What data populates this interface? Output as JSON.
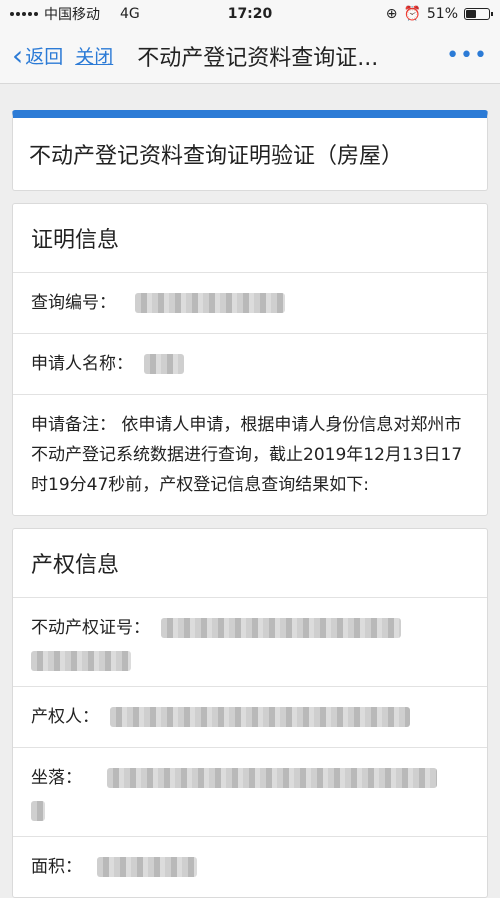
{
  "status_bar": {
    "carrier": "中国移动",
    "network": "4G",
    "time": "17:20",
    "battery": "51%",
    "battery_level": 0.51
  },
  "nav": {
    "back_label": "返回",
    "close_label": "关闭",
    "title": "不动产登记资料查询证..."
  },
  "document_title": "不动产登记资料查询证明验证（房屋）",
  "certificate_info": {
    "heading": "证明信息",
    "query_no_label": "查询编号：",
    "applicant_label": "申请人名称：",
    "remark": "申请备注： 依申请人申请，根据申请人身份信息对郑州市不动产登记系统数据进行查询，截止2019年12月13日17时19分47秒前，产权登记信息查询结果如下:"
  },
  "property_info": {
    "heading": "产权信息",
    "cert_no_label": "不动产权证号：",
    "owner_label": "产权人：",
    "location_label": "坐落：",
    "area_label": "面积："
  }
}
